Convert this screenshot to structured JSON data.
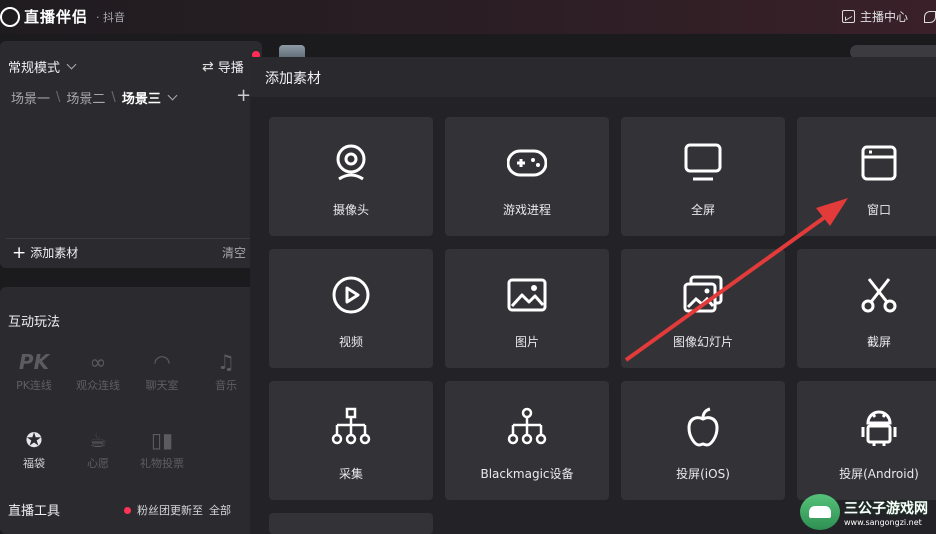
{
  "app": {
    "title": "直播伴侣",
    "platform": "· 抖音",
    "anchor_center": "主播中心"
  },
  "left_panel": {
    "mode": "常规模式",
    "guide": "导播",
    "scenes": [
      "场景一",
      "场景二",
      "场景三"
    ],
    "active_scene_index": 2,
    "add_material": "添加素材",
    "clear": "清空"
  },
  "interactive": {
    "title": "互动玩法",
    "tools": [
      {
        "label": "PK连线",
        "icon": "pk-icon",
        "enabled": false
      },
      {
        "label": "观众连线",
        "icon": "audience-link-icon",
        "enabled": false
      },
      {
        "label": "聊天室",
        "icon": "chatroom-icon",
        "enabled": false
      },
      {
        "label": "音乐",
        "icon": "music-icon",
        "enabled": false
      },
      {
        "label": "福袋",
        "icon": "lucky-bag-icon",
        "enabled": true
      },
      {
        "label": "心愿",
        "icon": "wish-icon",
        "enabled": false
      },
      {
        "label": "礼物投票",
        "icon": "gift-vote-icon",
        "enabled": false
      }
    ]
  },
  "live_tools": {
    "title": "直播工具",
    "fans_update": "粉丝团更新至",
    "all": "全部"
  },
  "dialog": {
    "title": "添加素材",
    "tiles": [
      {
        "label": "摄像头",
        "icon": "camera-icon"
      },
      {
        "label": "游戏进程",
        "icon": "gamepad-icon"
      },
      {
        "label": "全屏",
        "icon": "monitor-icon"
      },
      {
        "label": "窗口",
        "icon": "window-icon"
      },
      {
        "label": "视频",
        "icon": "play-icon"
      },
      {
        "label": "图片",
        "icon": "image-icon"
      },
      {
        "label": "图像幻灯片",
        "icon": "slideshow-icon"
      },
      {
        "label": "截屏",
        "icon": "scissors-icon"
      },
      {
        "label": "采集",
        "icon": "capture-icon"
      },
      {
        "label": "Blackmagic设备",
        "icon": "blackmagic-icon"
      },
      {
        "label": "投屏(iOS)",
        "icon": "apple-icon"
      },
      {
        "label": "投屏(Android)",
        "icon": "android-icon"
      }
    ]
  },
  "watermark": {
    "name": "三公子游戏网",
    "url": "www.sangongzi.net"
  },
  "colors": {
    "accent_red": "#ff2d55",
    "arrow": "#e33a3a",
    "tile_bg": "#333337"
  }
}
